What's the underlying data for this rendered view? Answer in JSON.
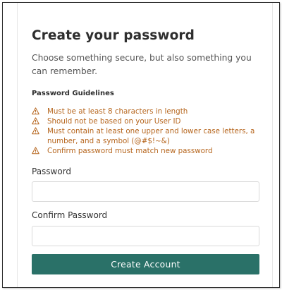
{
  "form": {
    "title": "Create your password",
    "subtitle": "Choose something secure, but also something you can remember.",
    "guidelines_heading": "Password Guidelines",
    "guidelines": [
      {
        "icon": "warning-icon",
        "text": "Must be at least 8 characters in length"
      },
      {
        "icon": "warning-icon",
        "text": "Should not be based on your User ID"
      },
      {
        "icon": "warning-icon",
        "text": "Must contain at least one upper and lower case letters, a number, and a symbol (@#$!~&)"
      },
      {
        "icon": "warning-icon",
        "text": "Confirm password must match new password"
      }
    ],
    "password_label": "Password",
    "password_value": "",
    "confirm_label": "Confirm Password",
    "confirm_value": "",
    "submit_label": "Create Account"
  },
  "colors": {
    "accent": "#2a7168",
    "warning": "#b6661e",
    "text": "#2e2e2e"
  }
}
